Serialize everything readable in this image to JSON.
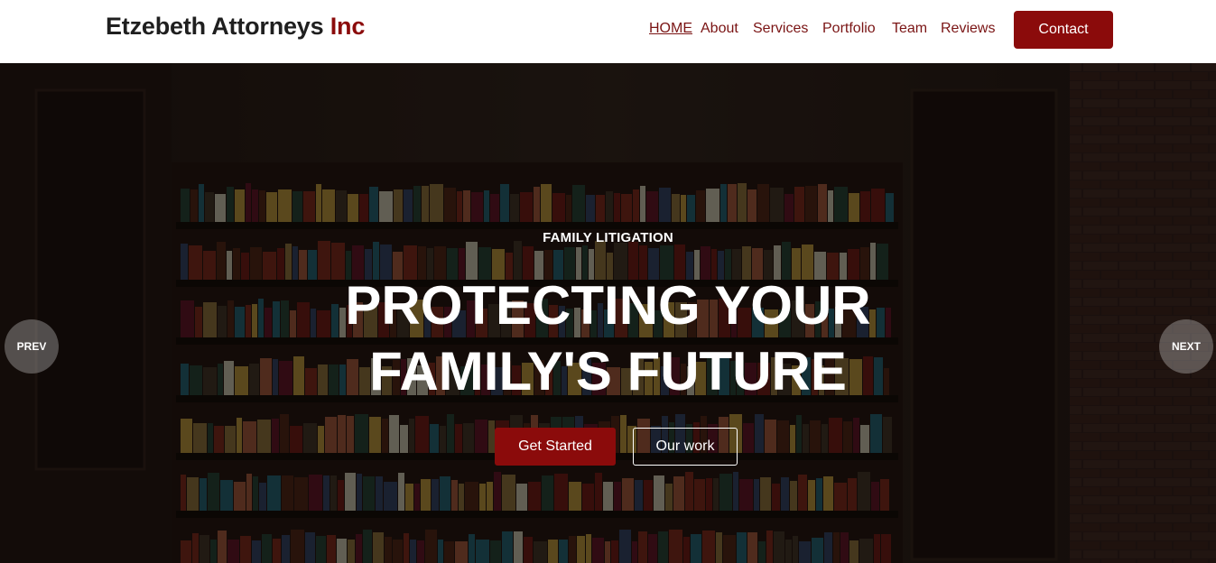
{
  "brand": {
    "name": "Etzebeth Attorneys",
    "accent": "Inc"
  },
  "nav": {
    "items": [
      {
        "label": "HOME",
        "active": true
      },
      {
        "label": "About"
      },
      {
        "label": "Services"
      },
      {
        "label": "Portfolio"
      },
      {
        "label": "Team"
      },
      {
        "label": "Reviews"
      }
    ],
    "contact_label": "Contact"
  },
  "hero": {
    "subtitle": "FAMILY LITIGATION",
    "title_line1": "PROTECTING YOUR",
    "title_line2": "FAMILY'S FUTURE",
    "primary_button": "Get Started",
    "secondary_button": "Our work",
    "prev_label": "PREV",
    "next_label": "NEXT"
  },
  "colors": {
    "accent": "#8b0b0b",
    "nav_text": "#7a1414",
    "header_bg": "#ffffff"
  }
}
